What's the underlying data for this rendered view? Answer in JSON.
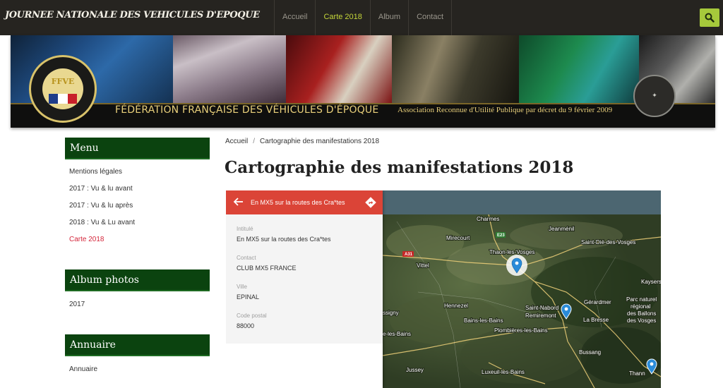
{
  "header": {
    "site_title": "JOURNEE NATIONALE DES VEHICULES D'EPOQUE",
    "nav": [
      {
        "label": "Accueil",
        "active": false
      },
      {
        "label": "Carte 2018",
        "active": true
      },
      {
        "label": "Album",
        "active": false
      },
      {
        "label": "Contact",
        "active": false
      }
    ],
    "search_icon": "search-icon",
    "accent_color": "#a6c93b"
  },
  "banner": {
    "federation": "FÉDÉRATION FRANÇAISE DES VÉHICULES D'ÉPOQUE",
    "subtitle": "Association Reconnue d'Utilité Publique par décret du 9 février 2009",
    "logo_text": "FFVE"
  },
  "sidebar": {
    "menu": {
      "title": "Menu",
      "items": [
        {
          "label": "Mentions légales",
          "active": false
        },
        {
          "label": "2017 : Vu & lu avant",
          "active": false
        },
        {
          "label": "2017 : Vu & lu après",
          "active": false
        },
        {
          "label": "2018 : Vu & Lu avant",
          "active": false
        },
        {
          "label": "Carte 2018",
          "active": true
        }
      ]
    },
    "album": {
      "title": "Album photos",
      "items": [
        {
          "label": "2017"
        }
      ]
    },
    "annuaire": {
      "title": "Annuaire",
      "items": [
        {
          "label": "Annuaire"
        }
      ]
    },
    "block_color": "#0b430f"
  },
  "main": {
    "breadcrumb": {
      "home": "Accueil",
      "separator": "/",
      "current": "Cartographie des manifestations 2018"
    },
    "page_title": "Cartographie des manifestations 2018"
  },
  "map": {
    "panel": {
      "title": "En MX5 sur la routes des Cra*tes",
      "header_color": "#db4437",
      "fields": [
        {
          "label": "Intitulé",
          "value": "En MX5 sur la routes des Cra*tes"
        },
        {
          "label": "Contact",
          "value": "CLUB MX5 FRANCE"
        },
        {
          "label": "Ville",
          "value": "EPINAL"
        },
        {
          "label": "Code postal",
          "value": "88000"
        }
      ]
    },
    "towns": [
      "Charmes",
      "Jeanménil",
      "Mirecourt",
      "Saint-Dié-des-Vosges",
      "Thaon-les-Vosges",
      "Vittel",
      "Kaysers",
      "Hennezel",
      "Saint-Nabord",
      "Gérardmer",
      "Parc naturel",
      "régional",
      "des Ballons",
      "des Vosges",
      "Remiremont",
      "La Bresse",
      "Bains-les-Bains",
      "Plombières-les-Bains",
      "Bussang",
      "Luxeuil-les-Bains",
      "Thann",
      "Jussey",
      "ssigny",
      "e-les-Bains"
    ],
    "roads": [
      "E23",
      "A31"
    ],
    "markers": [
      {
        "name": "Epinal",
        "selected": true
      },
      {
        "name": "Remiremont",
        "selected": false
      },
      {
        "name": "Thann",
        "selected": false
      }
    ],
    "marker_color": "#2a8bd8"
  }
}
